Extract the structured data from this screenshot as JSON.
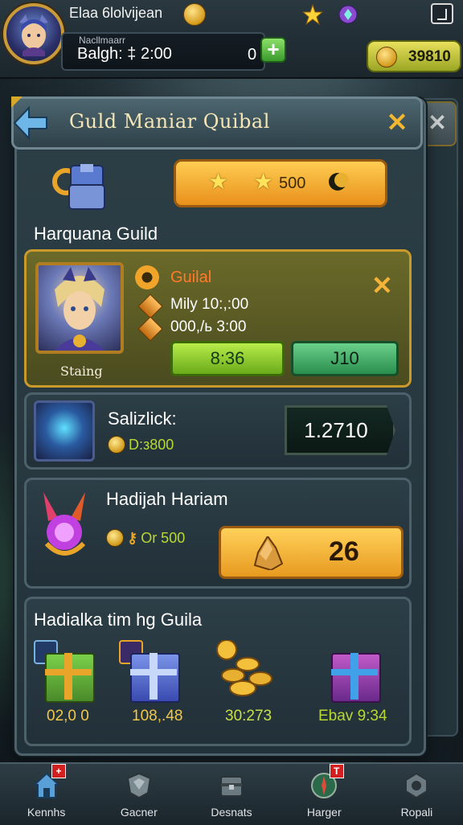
{
  "player": {
    "name": "Elaa 6lolvijean",
    "sub_label": "Nacllmaarr",
    "sub_value": "Balgh: ‡ 2:00",
    "sub_count": "0",
    "gold_pill_value": "39810"
  },
  "header": {
    "title": "Guld Maniar Quibal"
  },
  "resource_bar": {
    "value": "500"
  },
  "section": {
    "title": "Harquana Guild"
  },
  "featured_card": {
    "portrait_name": "Staing",
    "label": "Guilal",
    "line1": "Mily 10:,:00",
    "line2": "000,/ь 3:00",
    "btn1": "8:36",
    "btn2": "J10"
  },
  "card2": {
    "title": "Salizlick:",
    "sub": "D:з800",
    "pill_value": "1.2710"
  },
  "card3": {
    "title": "Hadijah Hariam",
    "sub": "Or 500",
    "button_value": "26"
  },
  "rewards": {
    "title": "Hadialka tim hg Guila",
    "items": [
      {
        "amount": "02,0 0",
        "color": "#f2c84a"
      },
      {
        "amount": "108,.48",
        "color": "#f2c84a"
      },
      {
        "amount": "30:273",
        "color": "#c8e04a"
      },
      {
        "amount": "Ebav 9:34",
        "color": "#b8d832"
      }
    ]
  },
  "nav": [
    {
      "label": "Kennhs",
      "icon": "home-icon",
      "badge": "+"
    },
    {
      "label": "Gacner",
      "icon": "shield-icon",
      "badge": ""
    },
    {
      "label": "Desnats",
      "icon": "chest-icon",
      "badge": ""
    },
    {
      "label": "Harger",
      "icon": "compass-icon",
      "badge": "T"
    },
    {
      "label": "Ropali",
      "icon": "settings-icon",
      "badge": ""
    }
  ],
  "colors": {
    "gold": "#e8a52a",
    "accent_orange": "#ff7a2a",
    "green": "#6aaa1a"
  }
}
